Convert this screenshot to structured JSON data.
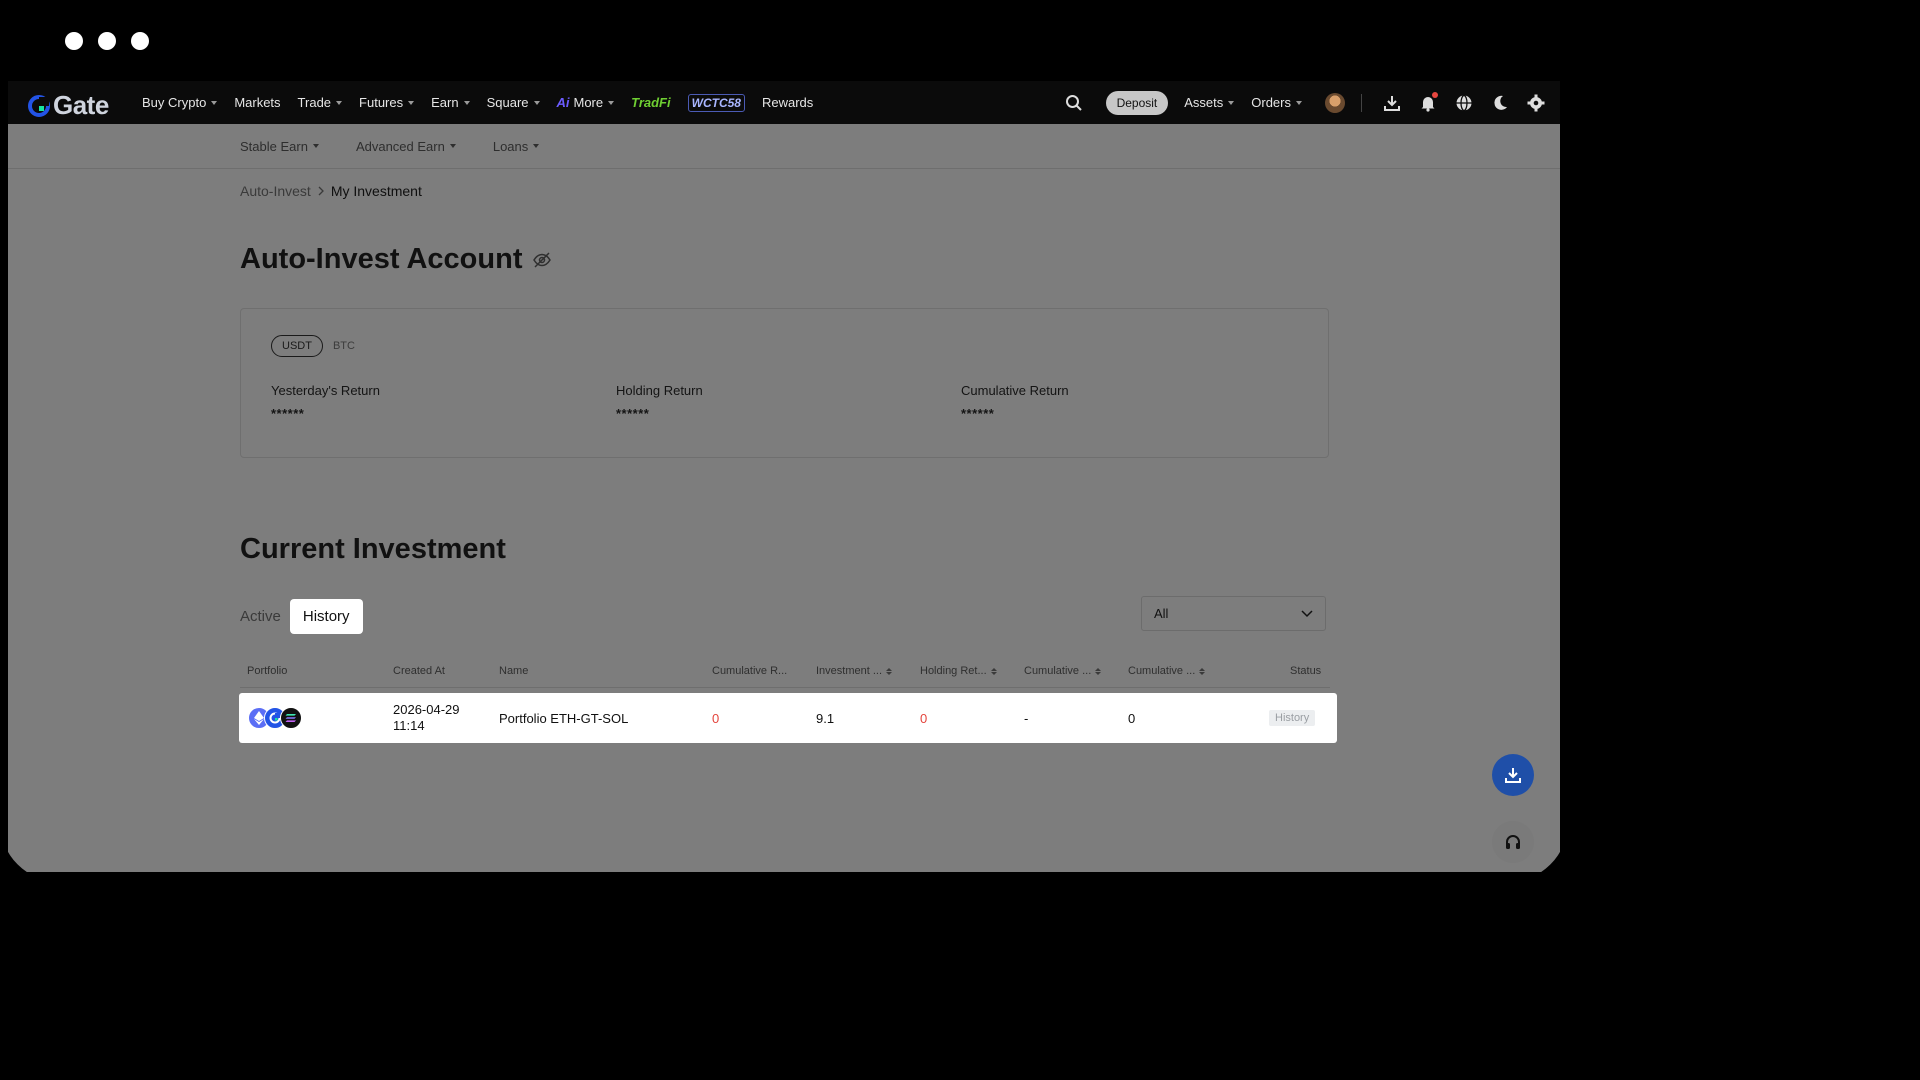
{
  "nav": {
    "logo": "Gate",
    "items": [
      {
        "label": "Buy Crypto",
        "caret": true
      },
      {
        "label": "Markets",
        "caret": false
      },
      {
        "label": "Trade",
        "caret": true
      },
      {
        "label": "Futures",
        "caret": true
      },
      {
        "label": "Earn",
        "caret": true
      },
      {
        "label": "Square",
        "caret": true
      }
    ],
    "ai_badge": "Ai",
    "more_label": "More",
    "tradfi_label": "TradFi",
    "wctc_label": "WCTC58",
    "rewards_label": "Rewards",
    "deposit_label": "Deposit",
    "assets_label": "Assets",
    "orders_label": "Orders"
  },
  "subnav": {
    "items": [
      "Stable Earn",
      "Advanced Earn",
      "Loans"
    ]
  },
  "breadcrumb": {
    "parent": "Auto-Invest",
    "current": "My Investment"
  },
  "account": {
    "title": "Auto-Invest Account",
    "currencies": [
      "USDT",
      "BTC"
    ],
    "selected_currency": "USDT",
    "stats": [
      {
        "label": "Yesterday's Return",
        "value": "******"
      },
      {
        "label": "Holding Return",
        "value": "******"
      },
      {
        "label": "Cumulative Return",
        "value": "******"
      }
    ]
  },
  "investment": {
    "title": "Current Investment",
    "tabs": [
      "Active",
      "History"
    ],
    "active_tab": "History",
    "filter_value": "All",
    "columns": [
      "Portfolio",
      "Created At",
      "Name",
      "Cumulative R...",
      "Investment ...",
      "Holding Ret...",
      "Cumulative ...",
      "Cumulative ...",
      "Status"
    ],
    "rows": [
      {
        "coins": [
          "ETH",
          "GT",
          "SOL"
        ],
        "created_date": "2026-04-29",
        "created_time": "11:14",
        "name": "Portfolio ETH-GT-SOL",
        "cumulative_return": "0",
        "investment": "9.1",
        "holding_return": "0",
        "cumulative_a": "-",
        "cumulative_b": "0",
        "status": "History"
      }
    ]
  },
  "colors": {
    "accent": "#2354e6",
    "negative": "#e4443c",
    "positive": "#6fcf32"
  }
}
